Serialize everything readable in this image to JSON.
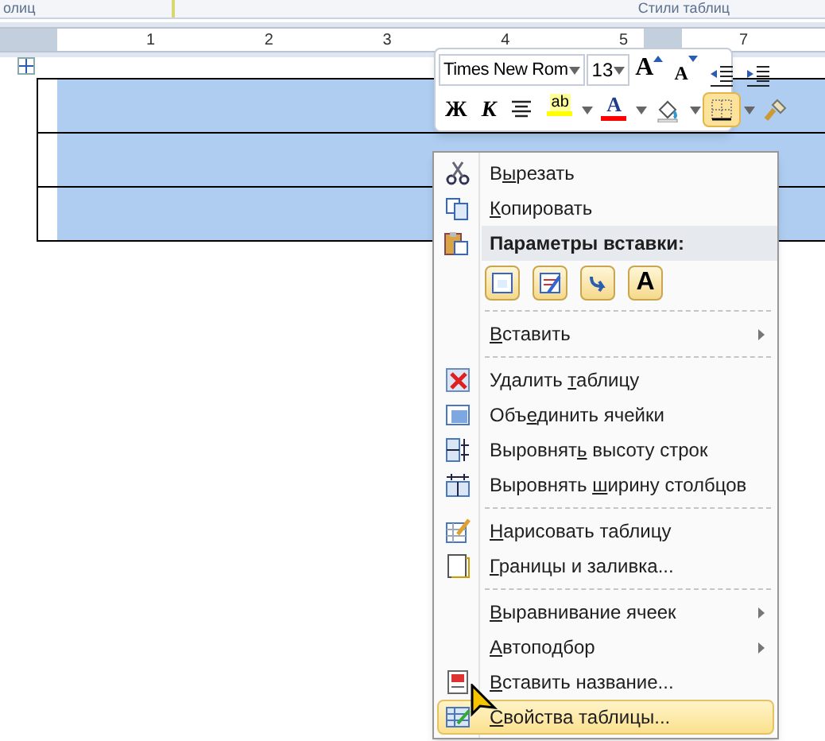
{
  "ribbon": {
    "group_labels": [
      "олиц",
      "Стили таблиц"
    ]
  },
  "ruler": {
    "numbers": [
      "1",
      "2",
      "3",
      "4",
      "5",
      "7"
    ]
  },
  "table": {
    "rows": [
      {
        "selected": true
      },
      {
        "selected": true
      },
      {
        "selected": true
      }
    ]
  },
  "mini_toolbar": {
    "font": "Times New Rom",
    "size": "13",
    "row1": [
      {
        "kind": "grow",
        "glyph": "A"
      },
      {
        "kind": "shrink",
        "glyph": "A"
      },
      {
        "kind": "outdent"
      },
      {
        "kind": "indent"
      }
    ],
    "row2": [
      {
        "kind": "bold",
        "glyph": "Ж",
        "selected": false
      },
      {
        "kind": "italic",
        "glyph": "К",
        "selected": false
      },
      {
        "kind": "center",
        "selected": false
      },
      {
        "kind": "highlight",
        "glyph": "ab",
        "color": "#ffff00",
        "selected": false
      },
      {
        "kind": "fontcolor",
        "glyph": "A",
        "color": "#ff0000",
        "selected": false
      },
      {
        "kind": "shading",
        "selected": false
      },
      {
        "kind": "borders",
        "selected": true
      },
      {
        "kind": "painter",
        "selected": false
      }
    ]
  },
  "context_menu": [
    {
      "kind": "item",
      "before": "В",
      "hotkey": "ы",
      "after": "резать",
      "submenu": false,
      "selected": false
    },
    {
      "kind": "item",
      "hotkey": "К",
      "after": "опировать",
      "submenu": false,
      "selected": false
    },
    {
      "kind": "header",
      "label": "Параметры вставки:"
    },
    {
      "kind": "paste_options",
      "options": [
        {
          "kind": "source"
        },
        {
          "kind": "merge"
        },
        {
          "kind": "picture"
        },
        {
          "kind": "text",
          "glyph": "A"
        }
      ]
    },
    {
      "kind": "separator"
    },
    {
      "kind": "item",
      "hotkey": "В",
      "after": "ставить",
      "submenu": true,
      "selected": false
    },
    {
      "kind": "separator"
    },
    {
      "kind": "item",
      "before": "Удалить ",
      "hotkey": "т",
      "after": "аблицу",
      "submenu": false,
      "selected": false
    },
    {
      "kind": "item",
      "before": "Объ",
      "hotkey": "е",
      "after": "динить ячейки",
      "submenu": false,
      "selected": false
    },
    {
      "kind": "item",
      "before": "Выровнят",
      "hotkey": "ь",
      "after": " высоту строк",
      "submenu": false,
      "selected": false
    },
    {
      "kind": "item",
      "before": "Выровнять ",
      "hotkey": "ш",
      "after": "ирину столбцов",
      "submenu": false,
      "selected": false
    },
    {
      "kind": "separator"
    },
    {
      "kind": "item",
      "hotkey": "Н",
      "after": "арисовать таблицу",
      "submenu": false,
      "selected": false
    },
    {
      "kind": "item",
      "hotkey": "Г",
      "after": "раницы и заливка...",
      "submenu": false,
      "selected": false
    },
    {
      "kind": "separator"
    },
    {
      "kind": "item",
      "hotkey": "В",
      "after": "ыравнивание ячеек",
      "submenu": true,
      "selected": false
    },
    {
      "kind": "item",
      "hotkey": "А",
      "after": "втоподбор",
      "submenu": true,
      "selected": false
    },
    {
      "kind": "item",
      "hotkey": "В",
      "after": "ставить название...",
      "submenu": false,
      "selected": false
    },
    {
      "kind": "item",
      "hotkey": "С",
      "after": "войства таблицы...",
      "submenu": false,
      "selected": true
    }
  ]
}
